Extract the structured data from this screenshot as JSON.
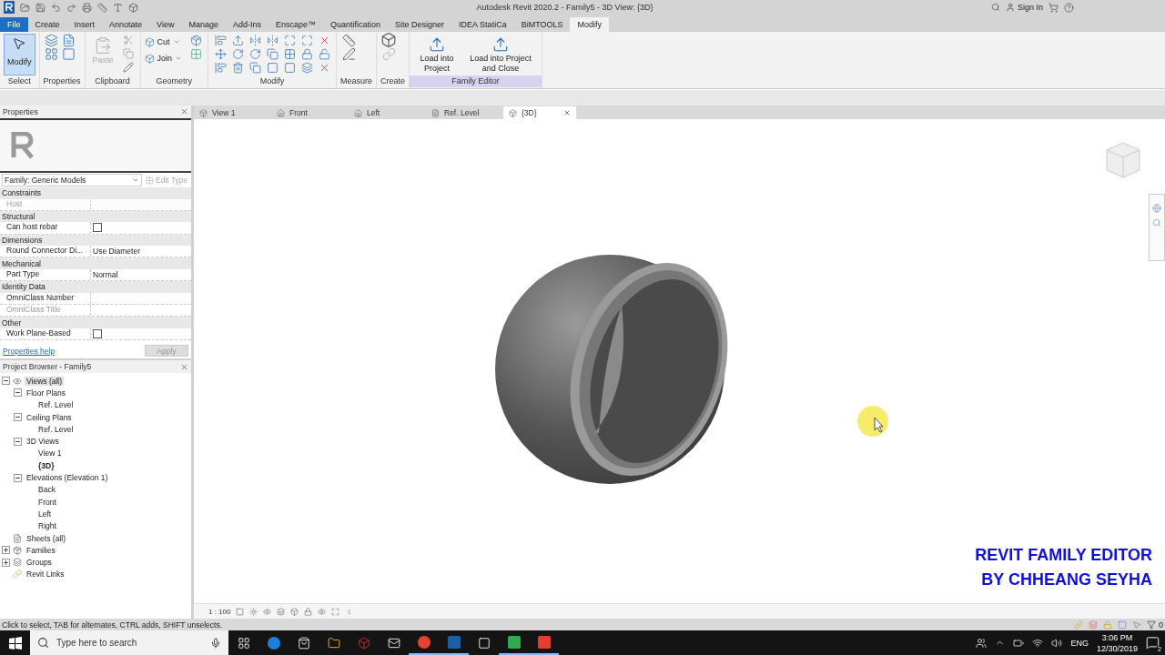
{
  "title_bar": {
    "title": "Autodesk Revit 2020.2 - Family5 - 3D View: {3D}",
    "sign_in": "Sign In"
  },
  "menu_tabs": [
    {
      "label": "File",
      "kind": "file",
      "selected": false
    },
    {
      "label": "Create",
      "kind": "tab",
      "selected": false
    },
    {
      "label": "Insert",
      "kind": "tab",
      "selected": false
    },
    {
      "label": "Annotate",
      "kind": "tab",
      "selected": false
    },
    {
      "label": "View",
      "kind": "tab",
      "selected": false
    },
    {
      "label": "Manage",
      "kind": "tab",
      "selected": false
    },
    {
      "label": "Add-Ins",
      "kind": "tab",
      "selected": false
    },
    {
      "label": "Enscape™",
      "kind": "tab",
      "selected": false
    },
    {
      "label": "Quantification",
      "kind": "tab",
      "selected": false
    },
    {
      "label": "Site Designer",
      "kind": "tab",
      "selected": false
    },
    {
      "label": "IDEA StatiCa",
      "kind": "tab",
      "selected": false
    },
    {
      "label": "BiMTOOLS",
      "kind": "tab",
      "selected": false
    },
    {
      "label": "Modify",
      "kind": "tab",
      "selected": true
    }
  ],
  "ribbon": {
    "panels": [
      {
        "kind": "select",
        "label": "Select",
        "highlighted": false,
        "tools": [
          {
            "label": "Modify",
            "selected": true
          }
        ]
      },
      {
        "kind": "properties",
        "label": "Properties",
        "highlighted": false
      },
      {
        "kind": "clipboard",
        "label": "Clipboard",
        "highlighted": false,
        "tools": [
          {
            "label": "Paste",
            "disabled": true
          }
        ]
      },
      {
        "kind": "geometry",
        "label": "Geometry",
        "highlighted": false,
        "tools": [
          {
            "label": "Cut"
          },
          {
            "label": "Join"
          }
        ]
      },
      {
        "kind": "modify",
        "label": "Modify",
        "highlighted": false
      },
      {
        "kind": "measure",
        "label": "Measure",
        "highlighted": false
      },
      {
        "kind": "create",
        "label": "Create",
        "highlighted": false
      },
      {
        "kind": "family-editor",
        "label": "Family Editor",
        "highlighted": true,
        "tools": [
          {
            "label": "Load into Project"
          },
          {
            "label": "Load into Project and Close"
          }
        ]
      }
    ]
  },
  "properties": {
    "title": "Properties",
    "type_selector": "Family: Generic Models",
    "edit_type": "Edit Type",
    "groups": [
      {
        "label": "Constraints",
        "params": [
          {
            "name": "Host",
            "kind": "text",
            "disabled": true
          }
        ]
      },
      {
        "label": "Structural",
        "params": [
          {
            "name": "Can host rebar",
            "kind": "checkbox",
            "checked": false,
            "disabled": false
          }
        ]
      },
      {
        "label": "Dimensions",
        "params": [
          {
            "name": "Round Connector Di...",
            "kind": "text",
            "value": "Use Diameter",
            "disabled": false
          }
        ]
      },
      {
        "label": "Mechanical",
        "params": [
          {
            "name": "Part Type",
            "kind": "text",
            "value": "Normal",
            "disabled": false
          }
        ]
      },
      {
        "label": "Identity Data",
        "params": [
          {
            "name": "OmniClass Number",
            "kind": "text",
            "disabled": false
          },
          {
            "name": "OmniClass Title",
            "kind": "text",
            "disabled": true
          }
        ]
      },
      {
        "label": "Other",
        "params": [
          {
            "name": "Work Plane-Based",
            "kind": "checkbox",
            "checked": false,
            "disabled": false
          }
        ]
      }
    ],
    "help_link": "Properties help",
    "apply": "Apply"
  },
  "project_browser": {
    "title": "Project Browser - Family5",
    "tree": [
      {
        "label": "Views (all)",
        "kind": "views",
        "expanded": true,
        "selected": true,
        "active": false,
        "children": [
          {
            "label": "Floor Plans",
            "expanded": true,
            "selected": false,
            "active": false,
            "children": [
              {
                "label": "Ref. Level",
                "selected": false,
                "active": false
              }
            ]
          },
          {
            "label": "Ceiling Plans",
            "expanded": true,
            "selected": false,
            "active": false,
            "children": [
              {
                "label": "Ref. Level",
                "selected": false,
                "active": false
              }
            ]
          },
          {
            "label": "3D Views",
            "expanded": true,
            "selected": false,
            "active": false,
            "children": [
              {
                "label": "View 1",
                "selected": false,
                "active": false
              },
              {
                "label": "{3D}",
                "selected": false,
                "active": true
              }
            ]
          },
          {
            "label": "Elevations (Elevation 1)",
            "expanded": true,
            "selected": false,
            "active": false,
            "children": [
              {
                "label": "Back",
                "selected": false,
                "active": false
              },
              {
                "label": "Front",
                "selected": false,
                "active": false
              },
              {
                "label": "Left",
                "selected": false,
                "active": false
              },
              {
                "label": "Right",
                "selected": false,
                "active": false
              }
            ]
          }
        ]
      },
      {
        "label": "Sheets (all)",
        "kind": "sheets",
        "selected": false,
        "active": false
      },
      {
        "label": "Families",
        "kind": "families",
        "expanded": false,
        "selected": false,
        "active": false
      },
      {
        "label": "Groups",
        "kind": "groups",
        "expanded": false,
        "selected": false,
        "active": false
      },
      {
        "label": "Revit Links",
        "kind": "links",
        "selected": false,
        "active": false
      }
    ]
  },
  "view_tabs": [
    {
      "label": "View 1",
      "kind": "perspective",
      "selected": false
    },
    {
      "label": "Front",
      "kind": "elevation",
      "selected": false
    },
    {
      "label": "Left",
      "kind": "elevation",
      "selected": false
    },
    {
      "label": "Ref. Level",
      "kind": "plan",
      "selected": false
    },
    {
      "label": "{3D}",
      "kind": "perspective",
      "selected": true
    }
  ],
  "view_control": {
    "scale": "1 : 100"
  },
  "caption": [
    "REVIT FAMILY EDITOR",
    "BY CHHEANG SEYHA"
  ],
  "status_bar": {
    "text": "Click to select, TAB for alternates, CTRL adds, SHIFT unselects.",
    "filter_count": "0"
  },
  "taskbar": {
    "search_placeholder": "Type here to search",
    "language": "ENG",
    "time": "3:06 PM",
    "date": "12/30/2019",
    "notifications": "2"
  }
}
